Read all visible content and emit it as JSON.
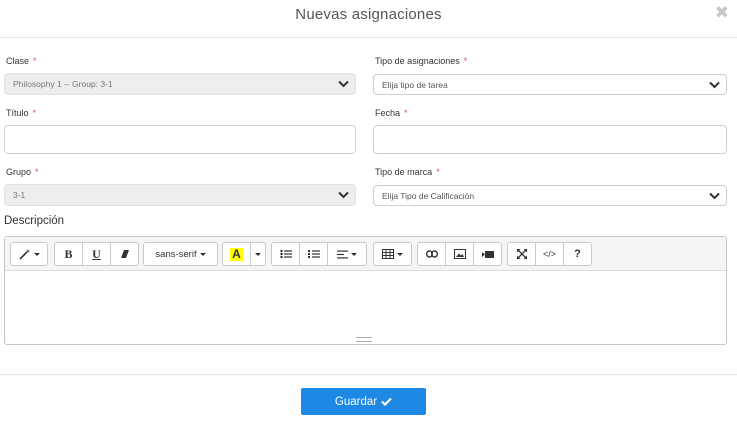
{
  "modal": {
    "title": "Nuevas asignaciones",
    "close_icon": "close-icon"
  },
  "form": {
    "clase": {
      "label": "Clase",
      "required_mark": "*",
      "value": "Philosophy 1 -- Group: 3-1"
    },
    "tipo_asignaciones": {
      "label": "Tipo de asignaciones",
      "required_mark": "*",
      "value": "Elija tipo de tarea"
    },
    "titulo": {
      "label": "Título",
      "required_mark": "*",
      "value": ""
    },
    "fecha": {
      "label": "Fecha",
      "required_mark": "*",
      "value": ""
    },
    "grupo": {
      "label": "Grupo",
      "required_mark": "*",
      "value": "3-1"
    },
    "tipo_marca": {
      "label": "Tipo de marca",
      "required_mark": "*",
      "value": "Elija Tipo de Calificación"
    },
    "descripcion": {
      "label": "Descripción"
    }
  },
  "editor": {
    "font_name": "sans-serif",
    "bold": "B",
    "underline": "U",
    "color_letter": "A",
    "help": "?",
    "code": "</>",
    "highlight_color": "#ffff00"
  },
  "footer": {
    "save_label": "Guardar"
  },
  "colors": {
    "primary": "#1e88e5",
    "required": "#d9534f"
  }
}
